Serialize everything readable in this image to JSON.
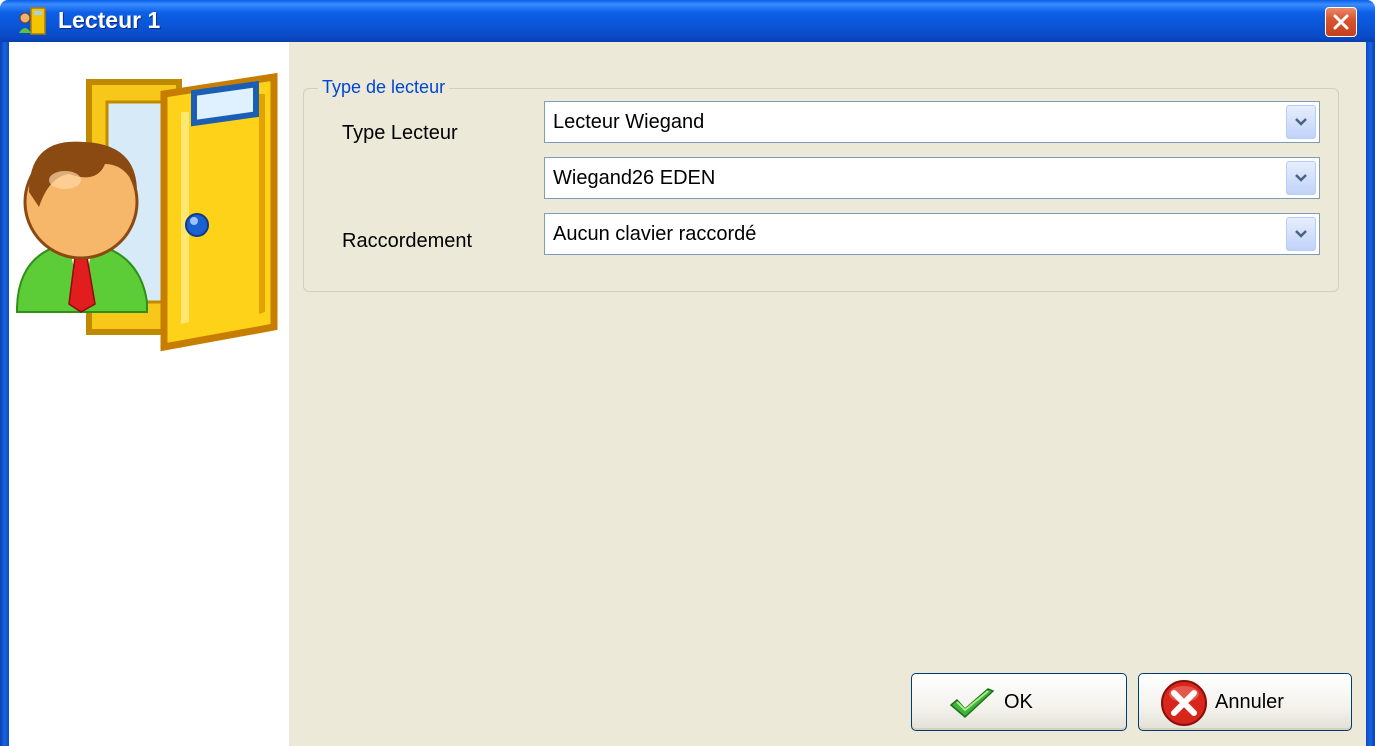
{
  "window": {
    "title": "Lecteur 1",
    "icon": "door-app-icon",
    "close_icon": "close-icon"
  },
  "groupbox": {
    "legend": "Type de lecteur"
  },
  "fields": {
    "type_label": "Type Lecteur",
    "type_value": "Lecteur Wiegand",
    "format_value": "Wiegand26 EDEN",
    "connection_label": "Raccordement",
    "connection_value": "Aucun clavier raccordé"
  },
  "buttons": {
    "ok_label": "OK",
    "cancel_label": "Annuler"
  },
  "colors": {
    "titlebar": "#0a55d8",
    "client": "#ece9d8",
    "legend": "#0046d5",
    "close": "#c43f1b"
  }
}
